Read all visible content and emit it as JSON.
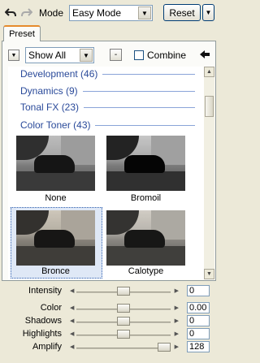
{
  "toolbar": {
    "mode_label": "Mode",
    "mode_value": "Easy Mode",
    "reset_label": "Reset"
  },
  "tab": {
    "label": "Preset"
  },
  "filter_bar": {
    "show_value": "Show All",
    "combine_label": "Combine"
  },
  "categories": [
    {
      "label": "Development (46)"
    },
    {
      "label": "Dynamics (9)"
    },
    {
      "label": "Tonal FX (23)"
    },
    {
      "label": "Color Toner (43)"
    }
  ],
  "presets": [
    {
      "label": "None"
    },
    {
      "label": "Bromoil"
    },
    {
      "label": "Bronce"
    },
    {
      "label": "Calotype"
    }
  ],
  "sliders": [
    {
      "label": "Intensity",
      "value": "0",
      "level": 0.5
    },
    {
      "label": "Color",
      "value": "0.00",
      "level": 0.5
    },
    {
      "label": "Shadows",
      "value": "0",
      "level": 0.5
    },
    {
      "label": "Highlights",
      "value": "0",
      "level": 0.5
    },
    {
      "label": "Amplify",
      "value": "128",
      "level": 1.0
    }
  ]
}
